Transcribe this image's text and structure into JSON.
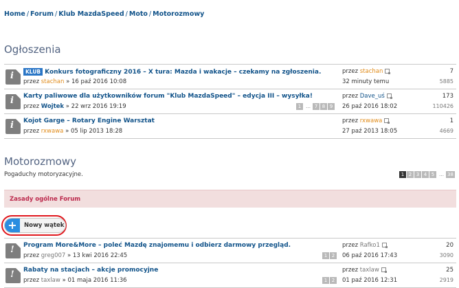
{
  "breadcrumb": [
    "Home",
    "Forum",
    "Klub MazdaSpeed",
    "Moto",
    "Motorozmowy"
  ],
  "announcements": {
    "title": "Ogłoszenia",
    "rows": [
      {
        "tag": "KLUB",
        "title": "Konkurs fotograficzny 2016 – X tura: Mazda i wakacje – czekamy na zgłoszenia.",
        "by": "przez",
        "author": "stachan",
        "date": "» 16 paź 2016 10:08",
        "last_by": "przez",
        "last_author": "stachan",
        "last_date": "32 minuty temu",
        "replies": "7",
        "views": "5885"
      },
      {
        "title": "Karty paliwowe dla użytkowników forum \"Klub MazdaSpeed\" – edycja III – wysyłka!",
        "by": "przez",
        "author": "Wojtek",
        "date": "» 22 wrz 2016 19:19",
        "pages": [
          "1",
          "…",
          "7",
          "8",
          "9"
        ],
        "last_by": "przez",
        "last_author": "Dave_uś",
        "last_date": "26 paź 2016 18:02",
        "replies": "173",
        "views": "110426"
      },
      {
        "title": "Kojot Garge – Rotary Engine Warsztat",
        "by": "przez",
        "author": "rxwawa",
        "date": "» 05 lip 2013 18:28",
        "last_by": "przez",
        "last_author": "rxwawa",
        "last_date": "27 paź 2013 18:05",
        "replies": "1",
        "views": "4669"
      }
    ]
  },
  "forum": {
    "title": "Motorozmowy",
    "description": "Pogaduchy motoryzacyjne.",
    "pagination": [
      "1",
      "2",
      "3",
      "4",
      "5",
      "…",
      "38"
    ],
    "rules": "Zasady ogólne Forum",
    "new_topic": "Nowy wątek",
    "rows": [
      {
        "title": "Program More&More – poleć Mazdę znajomemu i odbierz darmowy przegląd.",
        "by": "przez",
        "author": "greg007",
        "date": "» 13 kwi 2016 22:45",
        "pages": [
          "1",
          "2"
        ],
        "last_by": "przez",
        "last_author": "Rafko1",
        "last_date": "06 paź 2016 17:43",
        "replies": "20",
        "views": "3090"
      },
      {
        "title": "Rabaty na stacjach – akcje promocyjne",
        "by": "przez",
        "author": "taxlaw",
        "date": "» 01 maja 2016 11:36",
        "pages": [
          "1",
          "2"
        ],
        "last_by": "przez",
        "last_author": "taxlaw",
        "last_date": "01 paź 2016 12:31",
        "replies": "25",
        "views": "2919"
      }
    ]
  },
  "colors": {
    "link": "#105289",
    "accent": "#2a8de0",
    "rules_bg": "#f2dede",
    "rules_text": "#bc2a4d",
    "highlight": "#e0161c"
  }
}
